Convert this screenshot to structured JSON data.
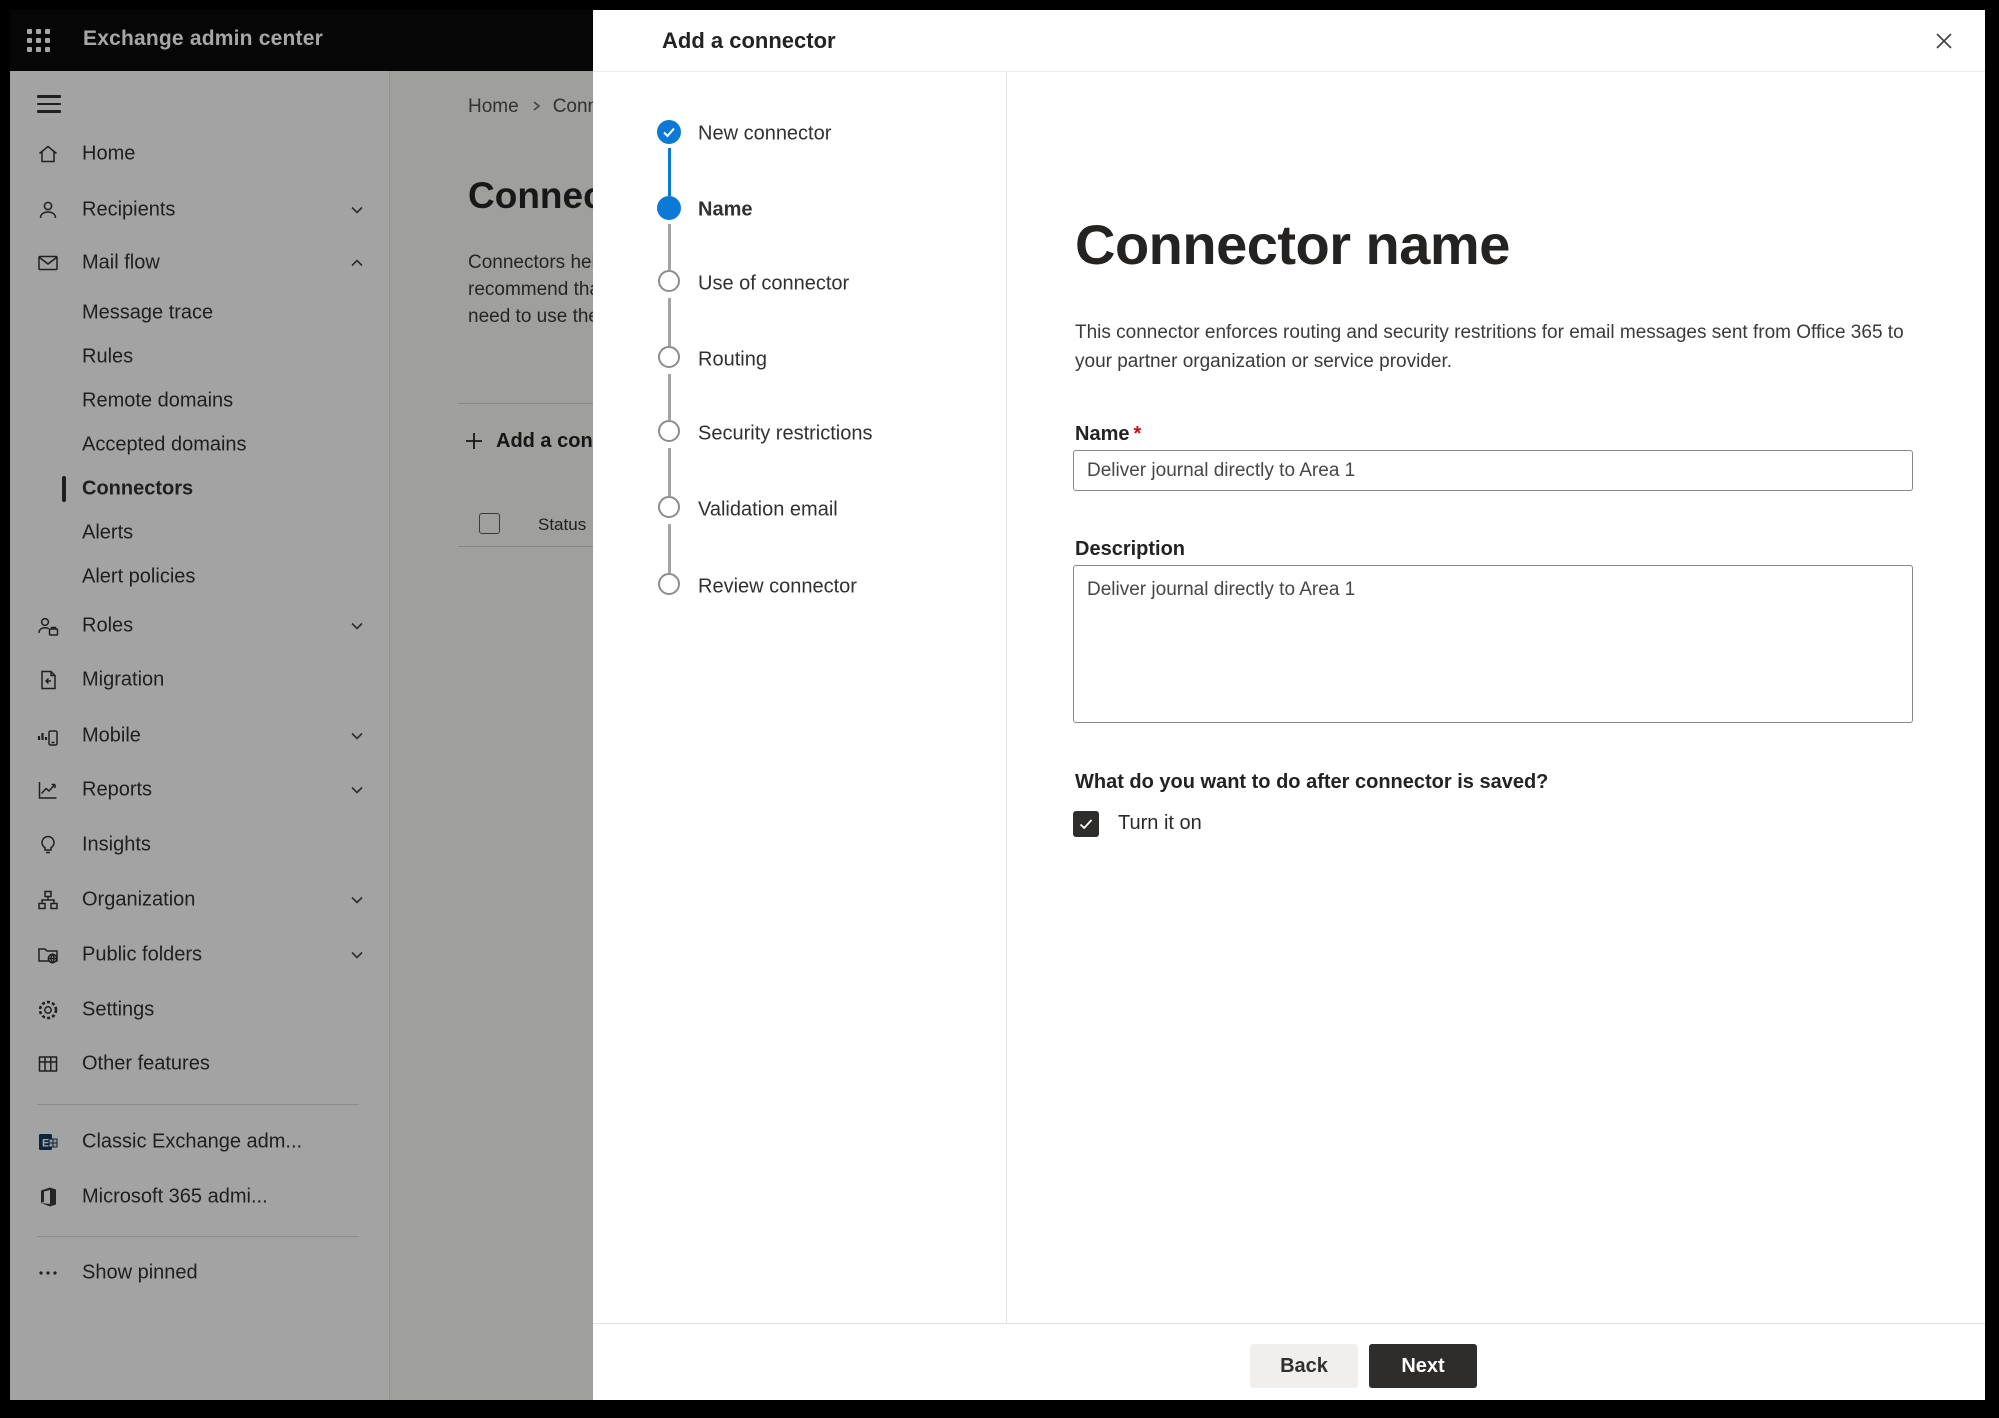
{
  "header": {
    "title": "Exchange admin center"
  },
  "sidebar": {
    "items": [
      {
        "type": "item",
        "label": "Home",
        "icon": "home-icon"
      },
      {
        "type": "item",
        "label": "Recipients",
        "icon": "person-icon",
        "chevron": "down"
      },
      {
        "type": "item",
        "label": "Mail flow",
        "icon": "mail-icon",
        "chevron": "up"
      },
      {
        "type": "subitem",
        "label": "Message trace"
      },
      {
        "type": "subitem",
        "label": "Rules"
      },
      {
        "type": "subitem",
        "label": "Remote domains"
      },
      {
        "type": "subitem",
        "label": "Accepted domains"
      },
      {
        "type": "subitem",
        "label": "Connectors",
        "selected": true
      },
      {
        "type": "subitem",
        "label": "Alerts"
      },
      {
        "type": "subitem",
        "label": "Alert policies"
      },
      {
        "type": "item",
        "label": "Roles",
        "icon": "roles-icon",
        "chevron": "down"
      },
      {
        "type": "item",
        "label": "Migration",
        "icon": "migration-icon"
      },
      {
        "type": "item",
        "label": "Mobile",
        "icon": "mobile-icon",
        "chevron": "down"
      },
      {
        "type": "item",
        "label": "Reports",
        "icon": "reports-icon",
        "chevron": "down"
      },
      {
        "type": "item",
        "label": "Insights",
        "icon": "insights-icon"
      },
      {
        "type": "item",
        "label": "Organization",
        "icon": "organization-icon",
        "chevron": "down"
      },
      {
        "type": "item",
        "label": "Public folders",
        "icon": "public-folders-icon",
        "chevron": "down"
      },
      {
        "type": "item",
        "label": "Settings",
        "icon": "settings-icon"
      },
      {
        "type": "item",
        "label": "Other features",
        "icon": "other-features-icon"
      },
      {
        "type": "divider"
      },
      {
        "type": "item",
        "label": "Classic Exchange adm...",
        "icon": "exchange-logo-icon"
      },
      {
        "type": "item",
        "label": "Microsoft 365 admi...",
        "icon": "office-logo-icon"
      },
      {
        "type": "divider"
      },
      {
        "type": "item",
        "label": "Show pinned",
        "icon": "ellipsis-icon"
      }
    ]
  },
  "background_page": {
    "breadcrumb": {
      "home": "Home",
      "current": "Connectors"
    },
    "title": "Connectors",
    "paragraph_lines": [
      "Connectors help",
      "recommend that",
      "need to use ther"
    ],
    "add_button_label": "Add a connector",
    "list_header": {
      "status_column": "Status"
    }
  },
  "wizard": {
    "title": "Add a connector",
    "steps": [
      {
        "label": "New connector",
        "state": "done"
      },
      {
        "label": "Name",
        "state": "current"
      },
      {
        "label": "Use of connector",
        "state": "todo"
      },
      {
        "label": "Routing",
        "state": "todo"
      },
      {
        "label": "Security restrictions",
        "state": "todo"
      },
      {
        "label": "Validation email",
        "state": "todo"
      },
      {
        "label": "Review connector",
        "state": "todo"
      }
    ],
    "page": {
      "title": "Connector name",
      "description": "This connector enforces routing and security restritions for email messages sent from Office 365 to your partner organization or service provider.",
      "name_label": "Name",
      "required_marker": "*",
      "name_value": "Deliver journal directly to Area 1",
      "description_label": "Description",
      "description_value": "Deliver journal directly to Area 1",
      "after_save_question": "What do you want to do after connector is saved?",
      "turn_on_label": "Turn it on",
      "turn_on_checked": true
    },
    "footer": {
      "back_label": "Back",
      "next_label": "Next"
    }
  },
  "colors": {
    "accent_blue": "#0b79d5",
    "primary_button": "#2e2d2c",
    "required_red": "#c50f1f",
    "topbar_black": "#0a0a0a"
  }
}
